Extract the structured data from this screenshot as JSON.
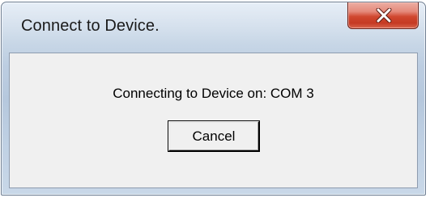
{
  "window": {
    "title": "Connect to Device."
  },
  "dialog": {
    "message": "Connecting to Device on: COM 3",
    "cancel_label": "Cancel"
  },
  "icons": {
    "close": "close-icon"
  },
  "colors": {
    "close_button": "#c9432b",
    "client_background": "#f0f0f0",
    "frame_glass": "#bccde1"
  }
}
